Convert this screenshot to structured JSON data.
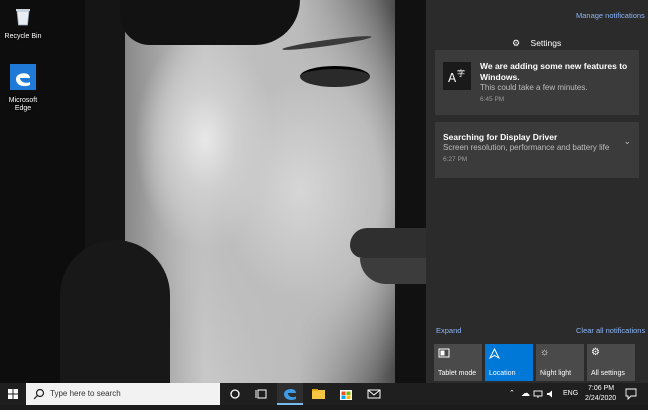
{
  "desktop": {
    "icons": [
      {
        "label": "Recycle Bin",
        "icon": "recycle-bin-icon"
      },
      {
        "label": "Microsoft Edge",
        "icon": "edge-icon"
      }
    ]
  },
  "action_center": {
    "manage_link": "Manage notifications",
    "settings_header": "Settings",
    "notifications": [
      {
        "title": "We are adding some new features to Windows.",
        "body": "This could take a few minutes.",
        "time": "6:45 PM",
        "icon": "language-icon"
      },
      {
        "title": "Searching for Display Driver",
        "body": "Screen resolution, performance and battery life",
        "time": "6:27 PM"
      }
    ],
    "expand_link": "Expand",
    "clear_link": "Clear all notifications",
    "quick_actions": [
      {
        "label": "Tablet mode",
        "icon": "tablet-mode-icon",
        "active": false
      },
      {
        "label": "Location",
        "icon": "location-icon",
        "active": true
      },
      {
        "label": "Night light",
        "icon": "night-light-icon",
        "active": false
      },
      {
        "label": "All settings",
        "icon": "gear-icon",
        "active": false
      }
    ]
  },
  "taskbar": {
    "search_placeholder": "Type here to search",
    "tray": {
      "language": "ENG",
      "time": "7:06 PM",
      "date": "2/24/2020"
    }
  },
  "colors": {
    "accent": "#0078d7",
    "panel_bg": "#2b2b2b",
    "card_bg": "#3b3b3b",
    "link": "#8ab4f8"
  }
}
